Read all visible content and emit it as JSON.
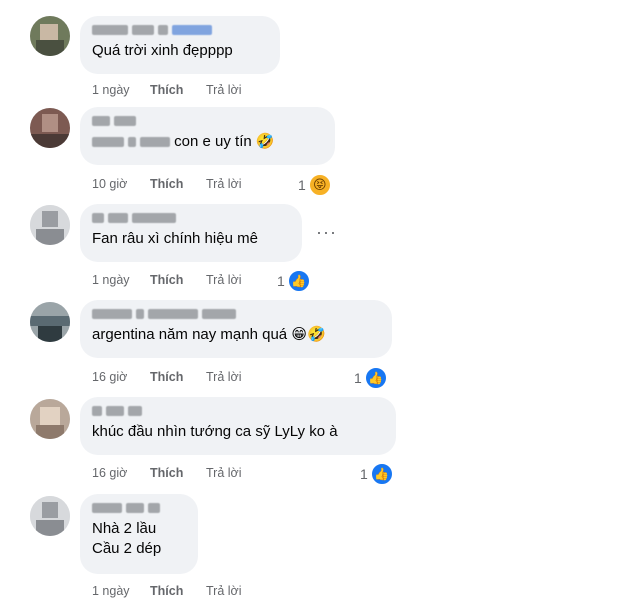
{
  "comments": [
    {
      "text": "Quá trời xinh đẹpppp",
      "time": "1 ngày",
      "like": "Thích",
      "reply": "Trả lời"
    },
    {
      "text": "con e uy tín",
      "emoji": "🤣",
      "time": "10 giờ",
      "like": "Thích",
      "reply": "Trả lời",
      "reaction_count": "1",
      "reaction_icon": "😝"
    },
    {
      "text": "Fan râu xì chính hiệu mê",
      "time": "1 ngày",
      "like": "Thích",
      "reply": "Trả lời",
      "reaction_count": "1",
      "more": "···"
    },
    {
      "text": "argentina năm nay mạnh quá",
      "emoji": "😁🤣",
      "time": "16 giờ",
      "like": "Thích",
      "reply": "Trả lời",
      "reaction_count": "1"
    },
    {
      "text": "khúc đầu nhìn tướng ca sỹ LyLy ko à",
      "time": "16 giờ",
      "like": "Thích",
      "reply": "Trả lời",
      "reaction_count": "1"
    },
    {
      "text_line1": "Nhà 2 lầu",
      "text_line2": "Cầu 2 dép",
      "time": "1 ngày",
      "like": "Thích",
      "reply": "Trả lời"
    }
  ],
  "icons": {
    "like": "👍",
    "haha": "😝"
  },
  "colors": {
    "bubble": "#f0f2f5",
    "meta": "#65676b",
    "like_blue": "#1877f2"
  }
}
